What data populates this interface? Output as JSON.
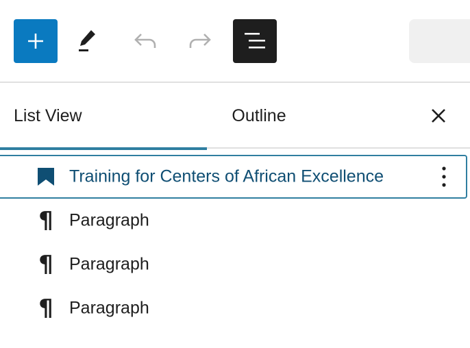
{
  "toolbar": {
    "buttons": [
      {
        "name": "add-block",
        "icon": "plus-icon"
      },
      {
        "name": "tools",
        "icon": "pencil-icon"
      },
      {
        "name": "undo",
        "icon": "undo-icon"
      },
      {
        "name": "redo",
        "icon": "redo-icon"
      },
      {
        "name": "document-overview",
        "icon": "list-view-icon"
      }
    ],
    "accent_color": "#0a7ac0"
  },
  "tabs": {
    "list_view": "List View",
    "outline": "Outline",
    "close_icon": "close-icon"
  },
  "blocks": [
    {
      "label": "Training for Centers of African Excellence",
      "icon": "bookmark-icon",
      "selected": true
    },
    {
      "label": "Paragraph",
      "icon": "paragraph-icon",
      "selected": false
    },
    {
      "label": "Paragraph",
      "icon": "paragraph-icon",
      "selected": false
    },
    {
      "label": "Paragraph",
      "icon": "paragraph-icon",
      "selected": false
    }
  ],
  "pilcrow_glyph": "¶",
  "selection_color": "#2f7ea0"
}
